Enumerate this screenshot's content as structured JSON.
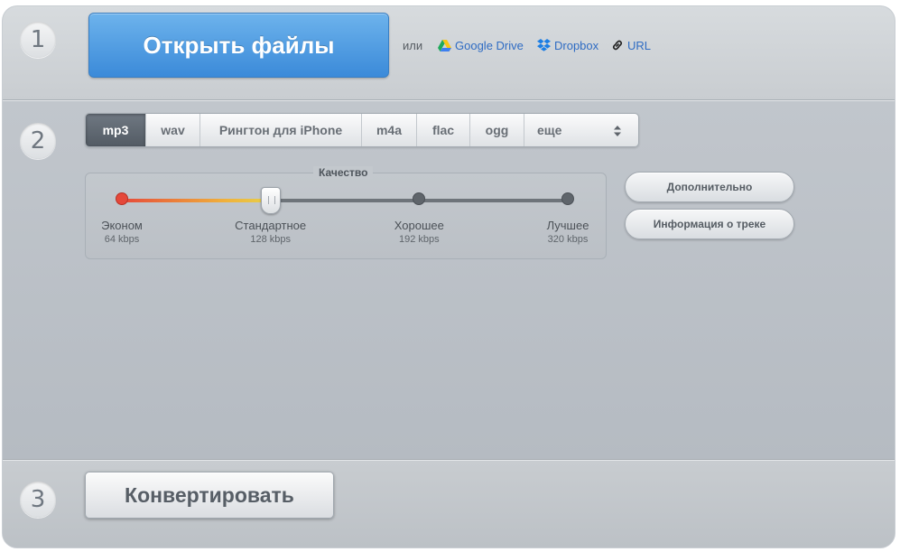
{
  "steps": {
    "one": "1",
    "two": "2",
    "three": "3"
  },
  "source": {
    "open_label": "Открыть файлы",
    "or_label": "или",
    "links": [
      {
        "label": "Google Drive",
        "icon": "google-drive-icon"
      },
      {
        "label": "Dropbox",
        "icon": "dropbox-icon"
      },
      {
        "label": "URL",
        "icon": "link-icon"
      }
    ]
  },
  "formats": {
    "selected": "mp3",
    "tabs": [
      "mp3",
      "wav",
      "Рингтон для iPhone",
      "m4a",
      "flac",
      "ogg",
      "еще"
    ]
  },
  "quality": {
    "title": "Качество",
    "selected_index": 1,
    "levels": [
      {
        "name": "Эконом",
        "rate": "64 kbps"
      },
      {
        "name": "Стандартное",
        "rate": "128 kbps"
      },
      {
        "name": "Хорошее",
        "rate": "192 kbps"
      },
      {
        "name": "Лучшее",
        "rate": "320 kbps"
      }
    ]
  },
  "side_buttons": {
    "advanced": "Дополнительно",
    "track_info": "Информация о треке"
  },
  "convert_label": "Конвертировать",
  "colors": {
    "accent_blue": "#3b8ad9",
    "link_blue": "#2f6cc3",
    "slider_red": "#e5483a",
    "slider_yellow": "#e6d04a"
  }
}
